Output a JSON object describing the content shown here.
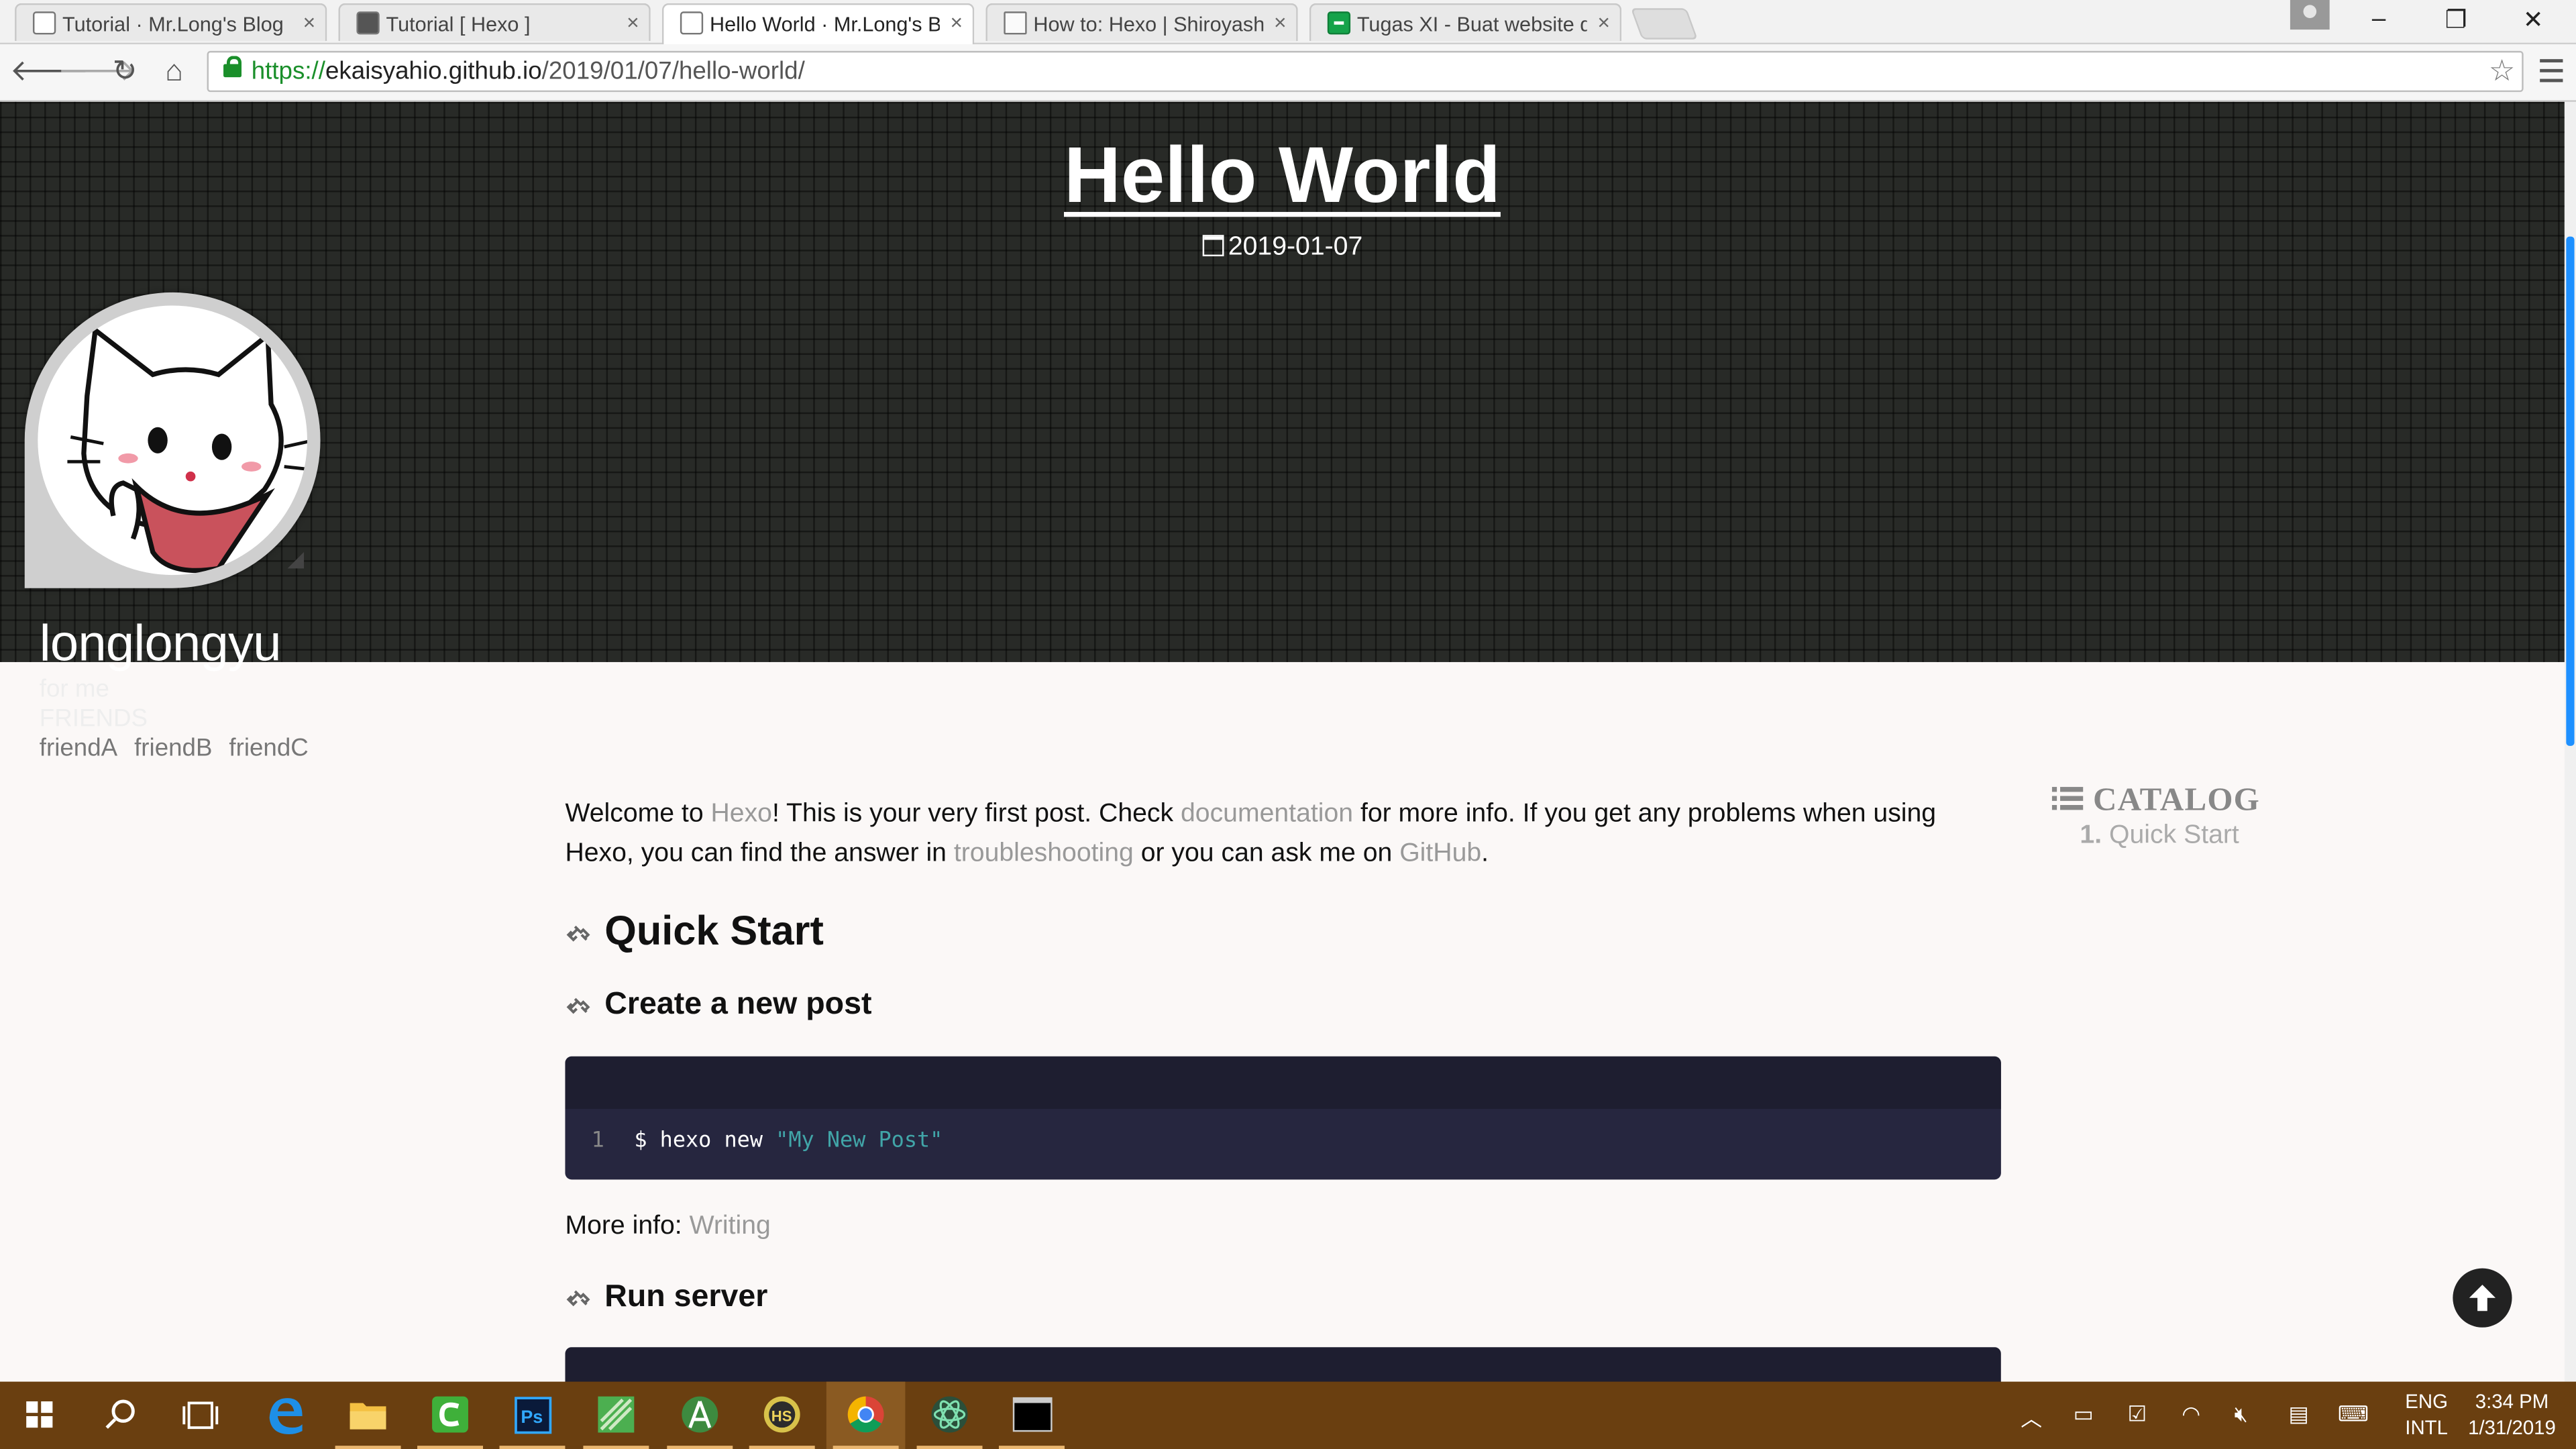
{
  "browser": {
    "tabs": [
      {
        "label": "Tutorial · Mr.Long's Blog",
        "favicon": "cat-favicon-icon",
        "active": false
      },
      {
        "label": "Tutorial [ Hexo ]",
        "favicon": "floppy-favicon-icon",
        "active": false
      },
      {
        "label": "Hello World · Mr.Long's Bl",
        "favicon": "cat-favicon-icon",
        "active": true
      },
      {
        "label": "How to: Hexo | Shiroyasha",
        "favicon": "document-favicon-icon",
        "active": false
      },
      {
        "label": "Tugas XI - Buat website d",
        "favicon": "sheets-favicon-icon",
        "active": false
      }
    ],
    "url_scheme": "https://",
    "url_host": "ekaisyahio.github.io",
    "url_path": "/2019/01/07/hello-world/"
  },
  "header": {
    "title": "Hello World",
    "date": "2019-01-07",
    "site_name": "longlongyu",
    "subtitle": "for me",
    "friends_title": "FRIENDS",
    "friends": [
      "friendA",
      "friendB",
      "friendC"
    ]
  },
  "article": {
    "intro_1": "Welcome to ",
    "link_hexo": "Hexo",
    "intro_2": "! This is your very first post. Check ",
    "link_docs": "documentation",
    "intro_3": " for more info. If you get any problems when using Hexo, you can find the answer in ",
    "link_troubleshooting": "troubleshooting",
    "intro_4": " or you can ask me on ",
    "link_github": "GitHub",
    "intro_5": ".",
    "h_quick_start": "Quick Start",
    "h_create_post": "Create a new post",
    "code1_line_no": "1",
    "code1_cmd": "$ hexo new ",
    "code1_str": "\"My New Post\"",
    "more_info_label": "More info: ",
    "more_info_link": "Writing",
    "h_run_server": "Run server"
  },
  "catalog": {
    "title": "CATALOG",
    "item_number": "1.",
    "item_label": "Quick Start"
  },
  "taskbar": {
    "lang_1": "ENG",
    "lang_2": "INTL",
    "time": "3:34 PM",
    "date": "1/31/2019"
  },
  "colors": {
    "header_bg": "#282a27",
    "link_gray": "#999999",
    "code_bg": "#26263f",
    "taskbar_bg": "#6a3f10",
    "accent_blue": "#1e90ff"
  }
}
